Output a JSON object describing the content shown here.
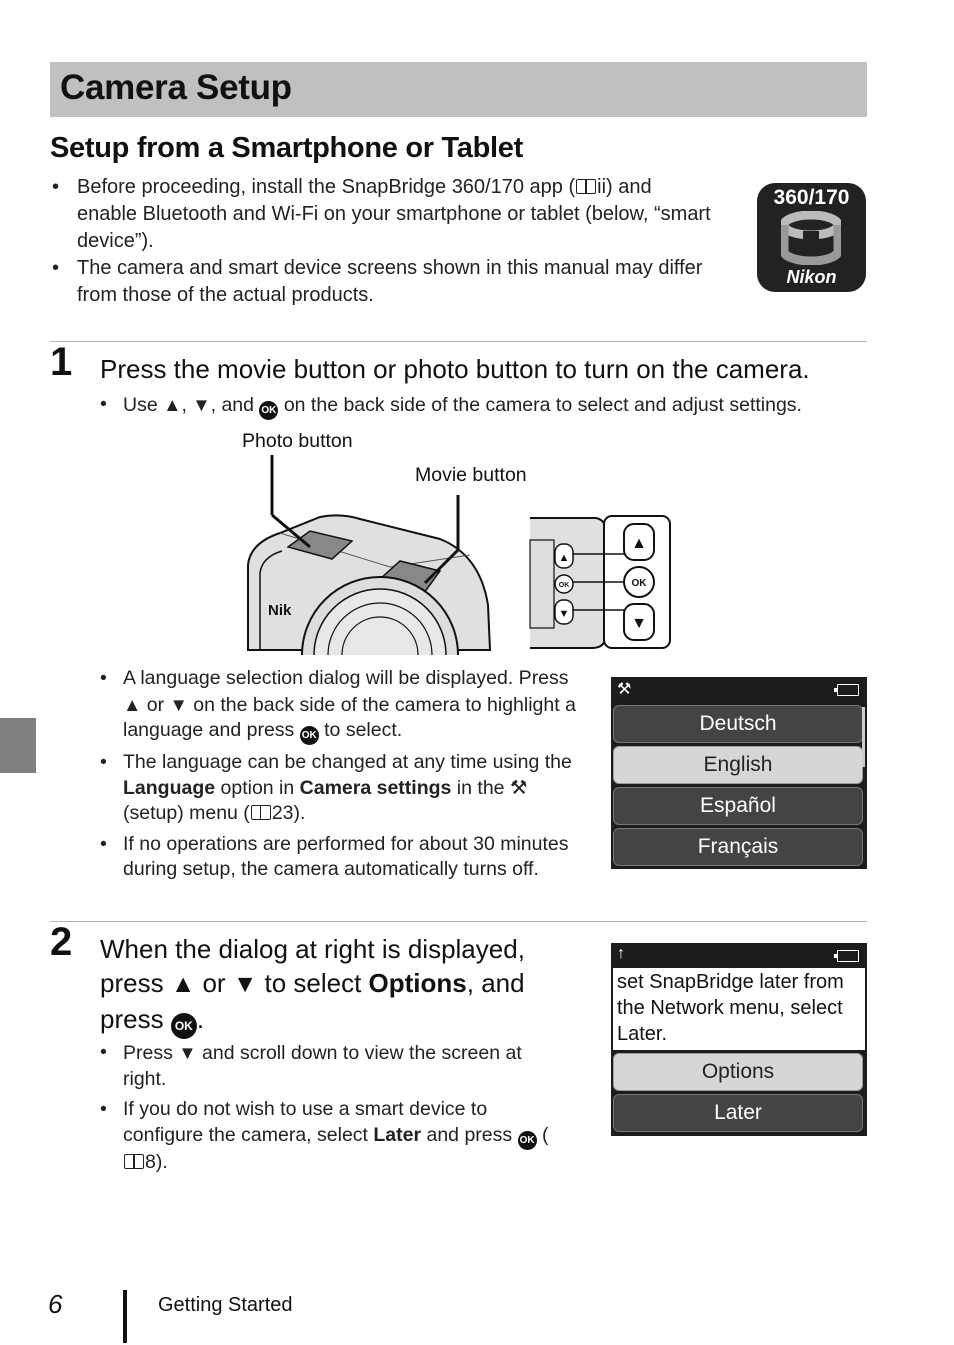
{
  "page": {
    "title": "Camera Setup",
    "subtitle": "Setup from a Smartphone or Tablet",
    "page_number": "6",
    "footer_section": "Getting Started"
  },
  "intro": {
    "bullets": [
      {
        "before": "Before proceeding, install the SnapBridge 360/170 app (",
        "ref": "ii",
        "after": ") and enable Bluetooth and Wi-Fi on your smartphone or tablet (below, “smart device”)."
      },
      {
        "text": "The camera and smart device screens shown in this manual may differ from those of the actual products."
      }
    ]
  },
  "app_icon": {
    "version": "360/170",
    "brand": "Nikon"
  },
  "step1": {
    "number": "1",
    "heading": "Press the movie button or photo button to turn on the camera.",
    "tip": {
      "a": "Use ",
      "b": ", ",
      "c": ", and ",
      "d": " on the back side of the camera to select and adjust settings."
    },
    "labels": {
      "photo_button": "Photo button",
      "movie_button": "Movie button"
    },
    "camera_buttons": {
      "up": "▲",
      "ok": "OK",
      "down": "▼"
    },
    "bullets": {
      "b1": {
        "a": "A language selection dialog will be displayed. Press ",
        "b": " or ",
        "c": " on the back side of the camera to highlight a language and press ",
        "d": " to select."
      },
      "b2": {
        "a": "The language can be changed at any time using the ",
        "bold1": "Language",
        "b": " option in ",
        "bold2": "Camera settings",
        "c": " in the ",
        "d": " (setup) menu (",
        "ref": "23",
        "e": ")."
      },
      "b3": {
        "text": "If no operations are performed for about 30 minutes during setup, the camera automatically turns off."
      }
    },
    "screen": {
      "status_icon": "setup-wrench",
      "languages": [
        "Deutsch",
        "English",
        "Español",
        "Français"
      ],
      "selected": "English"
    }
  },
  "step2": {
    "number": "2",
    "heading": {
      "a": "When the dialog at right is displayed, press ",
      "b": " or ",
      "c": " to select ",
      "bold": "Options",
      "d": ", and press ",
      "e": "."
    },
    "bullets": {
      "b1": {
        "a": "Press ",
        "b": " and scroll down to view the screen at right."
      },
      "b2": {
        "a": "If you do not wish to use a smart device to configure the camera, select ",
        "bold": "Later",
        "b": " and press ",
        "c": " (",
        "ref": "8",
        "d": ")."
      }
    },
    "screen": {
      "status_icon": "upload-arrow",
      "message": "set SnapBridge later from the Network menu, select Later.",
      "options": [
        "Options",
        "Later"
      ],
      "selected": "Options"
    }
  },
  "symbols": {
    "up": "▲",
    "down": "▼",
    "ok": "OK",
    "wrench": "⚒",
    "up_arrow": "↑",
    "bullet": "•"
  }
}
